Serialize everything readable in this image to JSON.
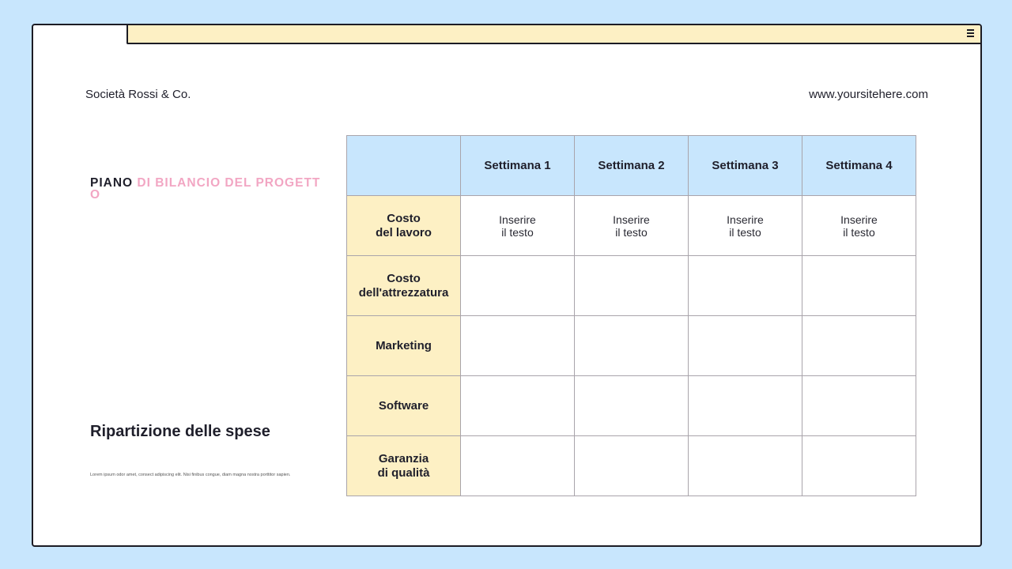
{
  "header": {
    "company": "Società Rossi & Co.",
    "website": "www.yoursitehere.com"
  },
  "left": {
    "title_part1": "PIANO ",
    "title_part2": "DI BILANCIO DEL PROGETTO",
    "subtitle": "Ripartizione delle spese",
    "body": "Lorem ipsum odor amet, consect adipiscing elit. Nisi finibus congue, diam magna nostra porttitor sapien."
  },
  "table": {
    "columns": [
      "Settimana 1",
      "Settimana 2",
      "Settimana 3",
      "Settimana 4"
    ],
    "rows": [
      {
        "label": "Costo\ndel lavoro",
        "cells": [
          "Inserire\nil testo",
          "Inserire\nil testo",
          "Inserire\nil testo",
          "Inserire\nil testo"
        ]
      },
      {
        "label": "Costo\ndell'attrezzatura",
        "cells": [
          "",
          "",
          "",
          ""
        ]
      },
      {
        "label": "Marketing",
        "cells": [
          "",
          "",
          "",
          ""
        ]
      },
      {
        "label": "Software",
        "cells": [
          "",
          "",
          "",
          ""
        ]
      },
      {
        "label": "Garanzia\ndi qualità",
        "cells": [
          "",
          "",
          "",
          ""
        ]
      }
    ]
  },
  "colors": {
    "background": "#c8e6fd",
    "header_fill": "#c8e6fd",
    "row_header_fill": "#fdf0c4",
    "accent_pink": "#f2a6c3"
  },
  "icons": {
    "menu": "hamburger-menu-icon"
  }
}
